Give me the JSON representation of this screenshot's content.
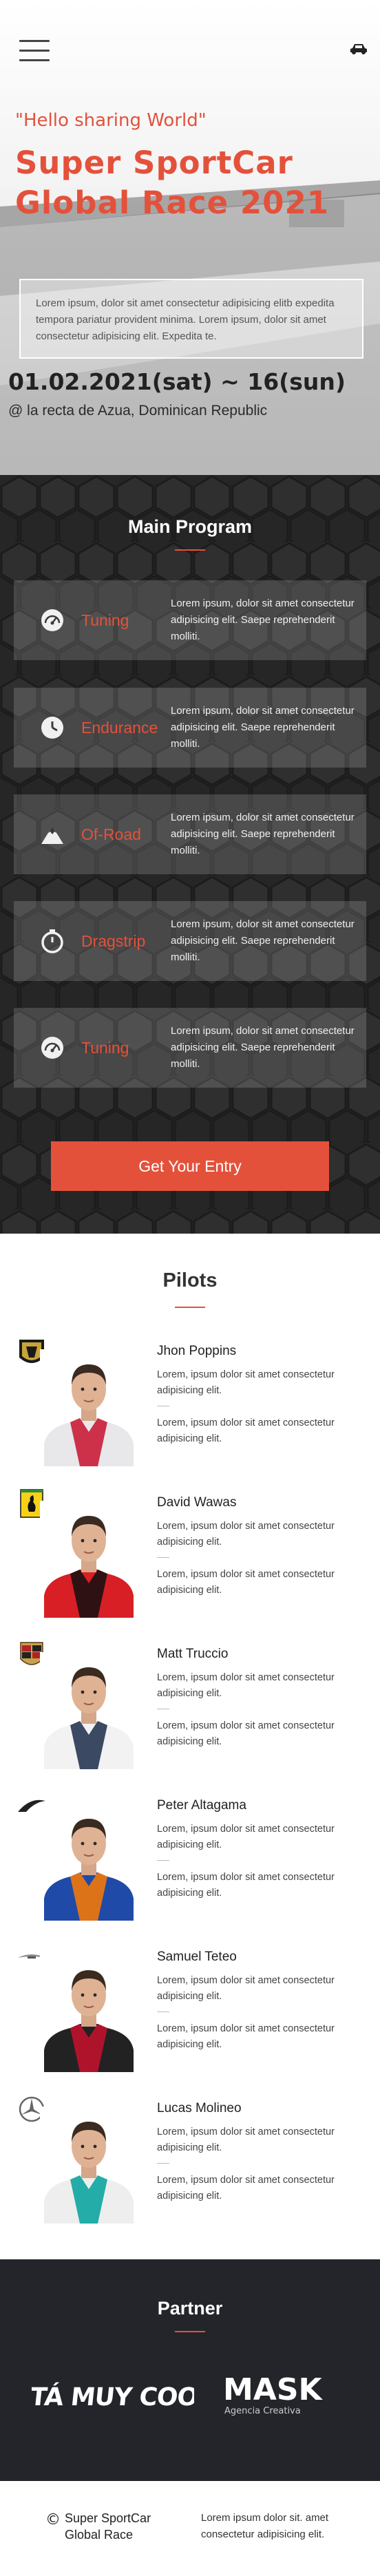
{
  "hero": {
    "quote": "\"Hello sharing World\"",
    "title": "Super SportCar Global Race 2021",
    "description": "Lorem ipsum, dolor sit amet consectetur adipisicing elitb expedita tempora pariatur provident minima. Lorem ipsum, dolor sit amet consectetur adipisicing elit. Expedita te.",
    "date": "01.02.2021(sat) ~ 16(sun)",
    "place": "@ la recta de Azua, Dominican Republic",
    "menu_icon": "hamburger-menu-icon",
    "car_icon": "car-icon"
  },
  "colors": {
    "accent": "#e4513b",
    "dark": "#262626",
    "partner_bg": "#24252a"
  },
  "program": {
    "title": "Main Program",
    "items": [
      {
        "label": "Tuning",
        "icon": "gauge-icon",
        "text": "Lorem ipsum, dolor sit amet consectetur adipisicing elit. Saepe reprehenderit molliti."
      },
      {
        "label": "Endurance",
        "icon": "clock-icon",
        "text": "Lorem ipsum, dolor sit amet consectetur adipisicing elit. Saepe reprehenderit molliti."
      },
      {
        "label": "Of-Road",
        "icon": "mountain-icon",
        "text": "Lorem ipsum, dolor sit amet consectetur adipisicing elit. Saepe reprehenderit molliti."
      },
      {
        "label": "Dragstrip",
        "icon": "stopwatch-icon",
        "text": "Lorem ipsum, dolor sit amet consectetur adipisicing elit. Saepe reprehenderit molliti."
      },
      {
        "label": "Tuning",
        "icon": "gauge-icon",
        "text": "Lorem ipsum, dolor sit amet consectetur adipisicing elit. Saepe reprehenderit molliti."
      }
    ],
    "entry_button": "Get Your Entry"
  },
  "pilots": {
    "title": "Pilots",
    "items": [
      {
        "name": "Jhon Poppins",
        "logo": "lamborghini-logo-icon",
        "text1": "Lorem, ipsum dolor sit amet consectetur adipisicing elit.",
        "text2": "Lorem, ipsum dolor sit amet consectetur adipisicing elit."
      },
      {
        "name": "David Wawas",
        "logo": "ferrari-logo-icon",
        "text1": "Lorem, ipsum dolor sit amet consectetur adipisicing elit.",
        "text2": "Lorem, ipsum dolor sit amet consectetur adipisicing elit."
      },
      {
        "name": "Matt Truccio",
        "logo": "porsche-logo-icon",
        "text1": "Lorem, ipsum dolor sit amet consectetur adipisicing elit.",
        "text2": "Lorem, ipsum dolor sit amet consectetur adipisicing elit."
      },
      {
        "name": "Peter Altagama",
        "logo": "mclaren-logo-icon",
        "text1": "Lorem, ipsum dolor sit amet consectetur adipisicing elit.",
        "text2": "Lorem, ipsum dolor sit amet consectetur adipisicing elit."
      },
      {
        "name": "Samuel Teteo",
        "logo": "aston-martin-logo-icon",
        "text1": "Lorem, ipsum dolor sit amet consectetur adipisicing elit.",
        "text2": "Lorem, ipsum dolor sit amet consectetur adipisicing elit."
      },
      {
        "name": "Lucas Molineo",
        "logo": "mercedes-logo-icon",
        "text1": "Lorem, ipsum dolor sit amet consectetur adipisicing elit.",
        "text2": "Lorem, ipsum dolor sit amet consectetur adipisicing elit."
      }
    ],
    "suit_colors": [
      "#e8e8ea",
      "#d81f26",
      "#f2f2f2",
      "#1f4aa8",
      "#222222",
      "#eeeeee"
    ],
    "trim_colors": [
      "#c8102e",
      "#111111",
      "#1b2b4a",
      "#ff7a00",
      "#c8102e",
      "#00a19b"
    ]
  },
  "partner": {
    "title": "Partner",
    "logo1": "ESTÁ MUY COOL!",
    "logo2_main": "MASK",
    "logo2_sub": "Agencia Creativa"
  },
  "footer": {
    "copyright": "©",
    "brand": "Super SportCar Global Race",
    "text": "Lorem ipsum dolor sit. amet consectetur adipisicing elit."
  }
}
